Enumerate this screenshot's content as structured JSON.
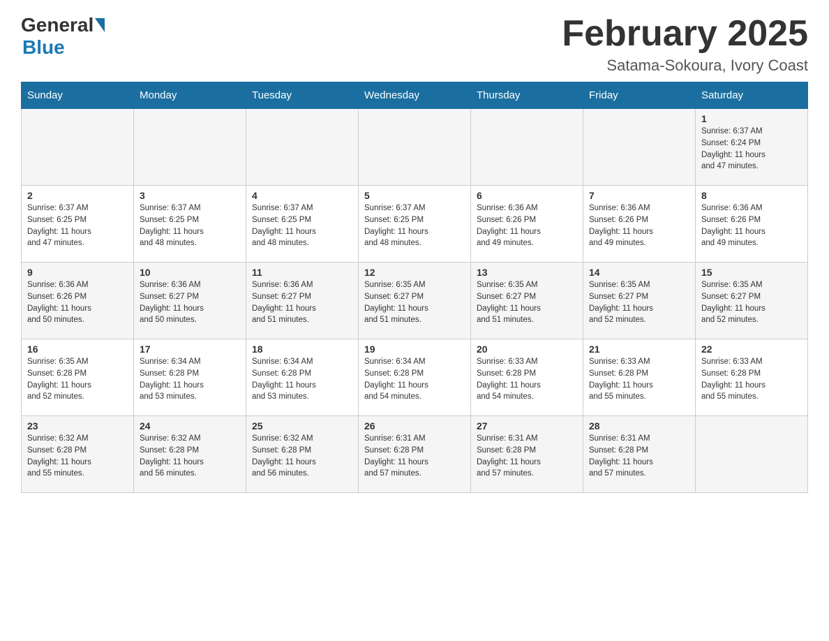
{
  "logo": {
    "general": "General",
    "blue": "Blue"
  },
  "header": {
    "title": "February 2025",
    "location": "Satama-Sokoura, Ivory Coast"
  },
  "weekdays": [
    "Sunday",
    "Monday",
    "Tuesday",
    "Wednesday",
    "Thursday",
    "Friday",
    "Saturday"
  ],
  "weeks": [
    [
      {
        "day": "",
        "info": ""
      },
      {
        "day": "",
        "info": ""
      },
      {
        "day": "",
        "info": ""
      },
      {
        "day": "",
        "info": ""
      },
      {
        "day": "",
        "info": ""
      },
      {
        "day": "",
        "info": ""
      },
      {
        "day": "1",
        "info": "Sunrise: 6:37 AM\nSunset: 6:24 PM\nDaylight: 11 hours\nand 47 minutes."
      }
    ],
    [
      {
        "day": "2",
        "info": "Sunrise: 6:37 AM\nSunset: 6:25 PM\nDaylight: 11 hours\nand 47 minutes."
      },
      {
        "day": "3",
        "info": "Sunrise: 6:37 AM\nSunset: 6:25 PM\nDaylight: 11 hours\nand 48 minutes."
      },
      {
        "day": "4",
        "info": "Sunrise: 6:37 AM\nSunset: 6:25 PM\nDaylight: 11 hours\nand 48 minutes."
      },
      {
        "day": "5",
        "info": "Sunrise: 6:37 AM\nSunset: 6:25 PM\nDaylight: 11 hours\nand 48 minutes."
      },
      {
        "day": "6",
        "info": "Sunrise: 6:36 AM\nSunset: 6:26 PM\nDaylight: 11 hours\nand 49 minutes."
      },
      {
        "day": "7",
        "info": "Sunrise: 6:36 AM\nSunset: 6:26 PM\nDaylight: 11 hours\nand 49 minutes."
      },
      {
        "day": "8",
        "info": "Sunrise: 6:36 AM\nSunset: 6:26 PM\nDaylight: 11 hours\nand 49 minutes."
      }
    ],
    [
      {
        "day": "9",
        "info": "Sunrise: 6:36 AM\nSunset: 6:26 PM\nDaylight: 11 hours\nand 50 minutes."
      },
      {
        "day": "10",
        "info": "Sunrise: 6:36 AM\nSunset: 6:27 PM\nDaylight: 11 hours\nand 50 minutes."
      },
      {
        "day": "11",
        "info": "Sunrise: 6:36 AM\nSunset: 6:27 PM\nDaylight: 11 hours\nand 51 minutes."
      },
      {
        "day": "12",
        "info": "Sunrise: 6:35 AM\nSunset: 6:27 PM\nDaylight: 11 hours\nand 51 minutes."
      },
      {
        "day": "13",
        "info": "Sunrise: 6:35 AM\nSunset: 6:27 PM\nDaylight: 11 hours\nand 51 minutes."
      },
      {
        "day": "14",
        "info": "Sunrise: 6:35 AM\nSunset: 6:27 PM\nDaylight: 11 hours\nand 52 minutes."
      },
      {
        "day": "15",
        "info": "Sunrise: 6:35 AM\nSunset: 6:27 PM\nDaylight: 11 hours\nand 52 minutes."
      }
    ],
    [
      {
        "day": "16",
        "info": "Sunrise: 6:35 AM\nSunset: 6:28 PM\nDaylight: 11 hours\nand 52 minutes."
      },
      {
        "day": "17",
        "info": "Sunrise: 6:34 AM\nSunset: 6:28 PM\nDaylight: 11 hours\nand 53 minutes."
      },
      {
        "day": "18",
        "info": "Sunrise: 6:34 AM\nSunset: 6:28 PM\nDaylight: 11 hours\nand 53 minutes."
      },
      {
        "day": "19",
        "info": "Sunrise: 6:34 AM\nSunset: 6:28 PM\nDaylight: 11 hours\nand 54 minutes."
      },
      {
        "day": "20",
        "info": "Sunrise: 6:33 AM\nSunset: 6:28 PM\nDaylight: 11 hours\nand 54 minutes."
      },
      {
        "day": "21",
        "info": "Sunrise: 6:33 AM\nSunset: 6:28 PM\nDaylight: 11 hours\nand 55 minutes."
      },
      {
        "day": "22",
        "info": "Sunrise: 6:33 AM\nSunset: 6:28 PM\nDaylight: 11 hours\nand 55 minutes."
      }
    ],
    [
      {
        "day": "23",
        "info": "Sunrise: 6:32 AM\nSunset: 6:28 PM\nDaylight: 11 hours\nand 55 minutes."
      },
      {
        "day": "24",
        "info": "Sunrise: 6:32 AM\nSunset: 6:28 PM\nDaylight: 11 hours\nand 56 minutes."
      },
      {
        "day": "25",
        "info": "Sunrise: 6:32 AM\nSunset: 6:28 PM\nDaylight: 11 hours\nand 56 minutes."
      },
      {
        "day": "26",
        "info": "Sunrise: 6:31 AM\nSunset: 6:28 PM\nDaylight: 11 hours\nand 57 minutes."
      },
      {
        "day": "27",
        "info": "Sunrise: 6:31 AM\nSunset: 6:28 PM\nDaylight: 11 hours\nand 57 minutes."
      },
      {
        "day": "28",
        "info": "Sunrise: 6:31 AM\nSunset: 6:28 PM\nDaylight: 11 hours\nand 57 minutes."
      },
      {
        "day": "",
        "info": ""
      }
    ]
  ]
}
